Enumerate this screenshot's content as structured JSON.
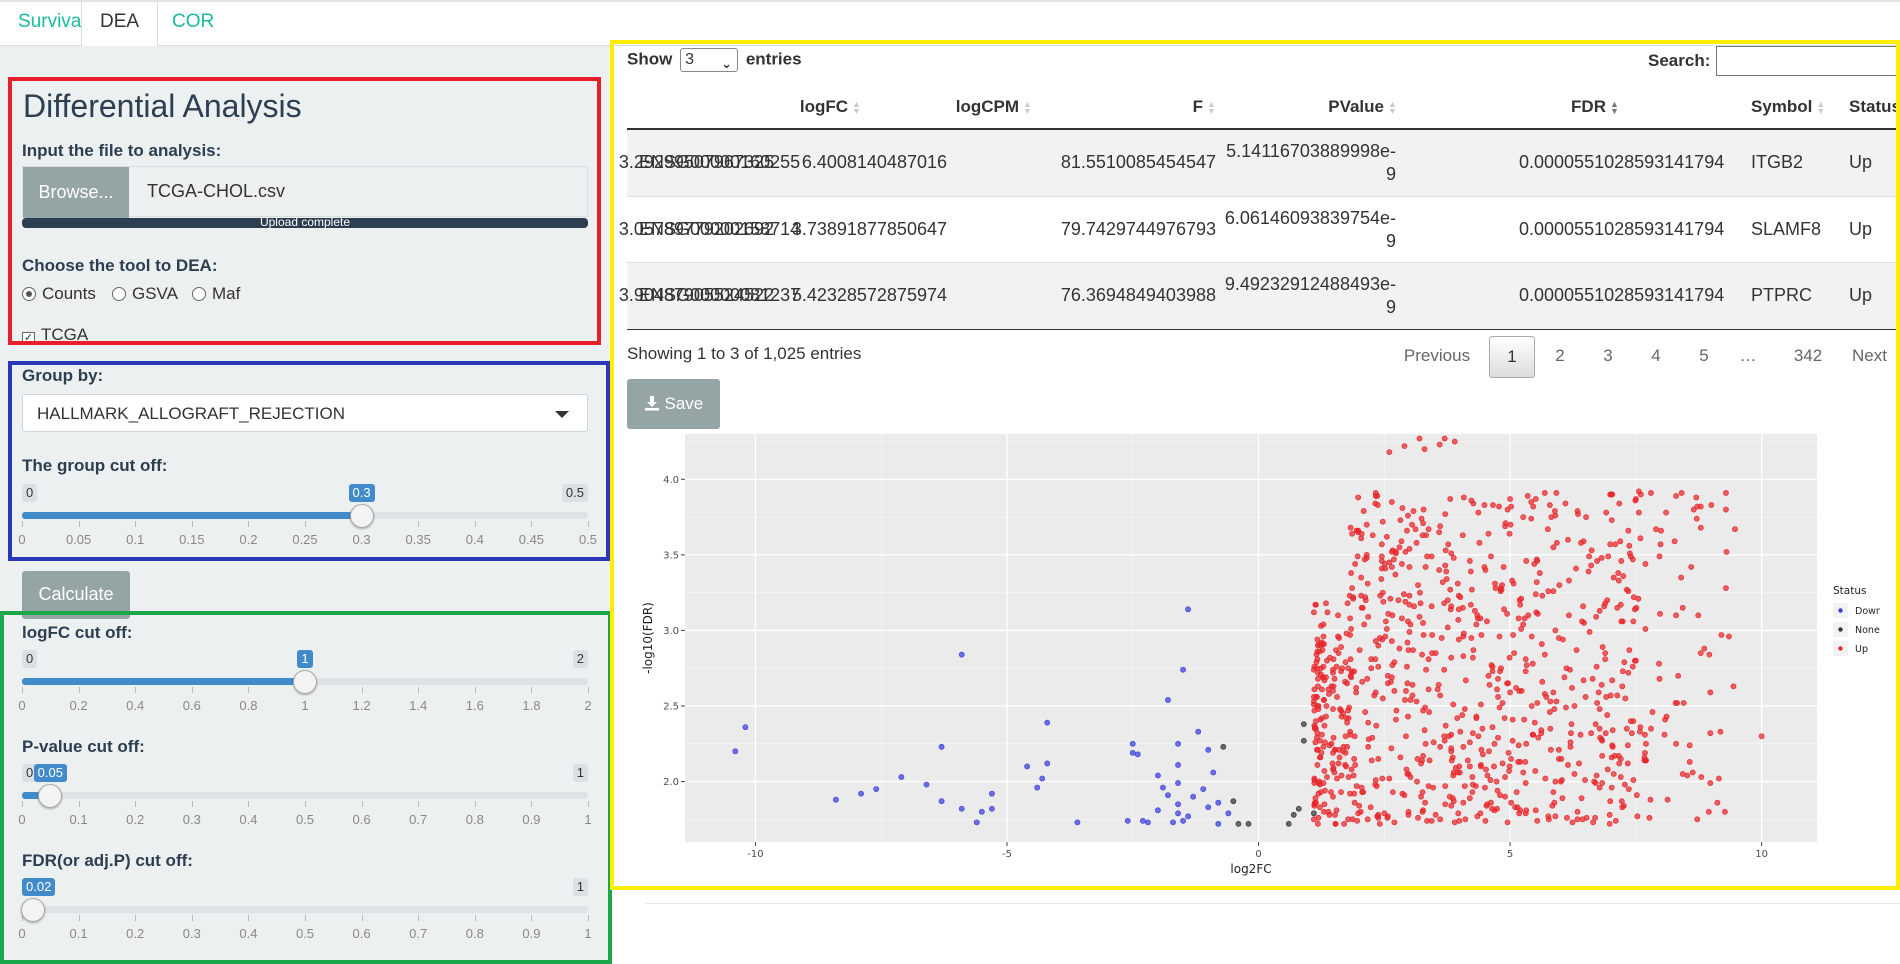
{
  "tabs": [
    {
      "label": "Survival",
      "active": false
    },
    {
      "label": "DEA",
      "active": true
    },
    {
      "label": "COR",
      "active": false
    }
  ],
  "sidebar": {
    "title": "Differential Analysis",
    "file_label": "Input the file to analysis:",
    "browse_label": "Browse...",
    "file_name": "TCGA-CHOL.csv",
    "upload_status": "Upload complete",
    "tool_label": "Choose the tool to DEA:",
    "tools": [
      {
        "label": "Counts",
        "selected": true
      },
      {
        "label": "GSVA",
        "selected": false
      },
      {
        "label": "Maf",
        "selected": false
      }
    ],
    "tcga_label": "TCGA",
    "tcga_checked": true,
    "group_label": "Group by:",
    "group_value": "HALLMARK_ALLOGRAFT_REJECTION",
    "calculate_label": "Calculate",
    "sliders": [
      {
        "label": "The group cut off:",
        "min": "0",
        "max": "0.5",
        "value": "0.3",
        "fraction": 0.6,
        "ticks": [
          "0",
          "0.05",
          "0.1",
          "0.15",
          "0.2",
          "0.25",
          "0.3",
          "0.35",
          "0.4",
          "0.45",
          "0.5"
        ]
      },
      {
        "label": "logFC cut off:",
        "min": "0",
        "max": "2",
        "value": "1",
        "fraction": 0.5,
        "ticks": [
          "0",
          "0.2",
          "0.4",
          "0.6",
          "0.8",
          "1",
          "1.2",
          "1.4",
          "1.6",
          "1.8",
          "2"
        ]
      },
      {
        "label": "P-value cut off:",
        "min": "0",
        "max": "1",
        "value": "0.05",
        "fraction": 0.05,
        "ticks": [
          "0",
          "0.1",
          "0.2",
          "0.3",
          "0.4",
          "0.5",
          "0.6",
          "0.7",
          "0.8",
          "0.9",
          "1"
        ]
      },
      {
        "label": "FDR(or adj.P) cut off:",
        "min": "0",
        "max": "1",
        "value": "0.02",
        "fraction": 0.02,
        "ticks": [
          "0",
          "0.1",
          "0.2",
          "0.3",
          "0.4",
          "0.5",
          "0.6",
          "0.7",
          "0.8",
          "0.9",
          "1"
        ]
      }
    ]
  },
  "table": {
    "show_label": "Show",
    "entries_label": "entries",
    "page_length": "3",
    "search_label": "Search:",
    "search_value": "",
    "columns": [
      "logFC",
      "logCPM",
      "F",
      "PValue",
      "FDR",
      "Symbol",
      "Status"
    ],
    "rows": [
      {
        "id": "ENSG00000160255",
        "logFC": "3.29299507967325",
        "logCPM": "6.4008140487016",
        "F": "81.5510085454547",
        "PValue_a": "5.14116703889998e-",
        "PValue_b": "9",
        "FDR": "0.0000551028593141794",
        "Symbol": "ITGB2",
        "Status": "Up"
      },
      {
        "id": "ENSG00000158714",
        "logFC": "3.05789779202692",
        "logCPM": "3.73891877850647",
        "F": "79.7429744976793",
        "PValue_a": "6.06146093839754e-",
        "PValue_b": "9",
        "FDR": "0.0000551028593141794",
        "Symbol": "SLAMF8",
        "Status": "Up"
      },
      {
        "id": "ENSG00000081237",
        "logFC": "3.90487905524522",
        "logCPM": "5.42328572875974",
        "F": "76.3694849403988",
        "PValue_a": "9.49232912488493e-",
        "PValue_b": "9",
        "FDR": "0.0000551028593141794",
        "Symbol": "PTPRC",
        "Status": "Up"
      }
    ],
    "info": "Showing 1 to 3 of 1,025 entries",
    "pager": [
      "Previous",
      "1",
      "2",
      "3",
      "4",
      "5",
      "…",
      "342",
      "Next"
    ]
  },
  "save_label": "Save",
  "colors": {
    "down": "#3b3bdf",
    "none": "#333333",
    "up": "#e8262b",
    "plot_bg": "#ebebeb",
    "accent": "#18bc9c",
    "slider": "#428bca",
    "highlight_red": "#e5202a",
    "highlight_blue": "#2a37b8",
    "highlight_green": "#1aa84a",
    "highlight_yellow": "#ffee00"
  },
  "chart_data": {
    "type": "scatter",
    "xlabel": "log2FC",
    "ylabel": "-log10(FDR)",
    "xlim": [
      -11.4,
      11.1
    ],
    "ylim": [
      1.6,
      4.3
    ],
    "x_ticks": [
      -10,
      -5,
      0,
      5,
      10
    ],
    "x_tick_labels": [
      "-10",
      "-5",
      "0",
      "5",
      "10"
    ],
    "y_ticks": [
      2.0,
      2.5,
      3.0,
      3.5,
      4.0
    ],
    "y_tick_labels": [
      "2.0",
      "2.5",
      "3.0",
      "3.5",
      "4.0"
    ],
    "grid": true,
    "legend_title": "Status",
    "legend_position": "right",
    "series": [
      {
        "name": "Down",
        "color": "#3b3bdf",
        "points": [
          [
            -10.4,
            2.2
          ],
          [
            -10.2,
            2.36
          ],
          [
            -8.4,
            1.88
          ],
          [
            -7.9,
            1.92
          ],
          [
            -7.6,
            1.95
          ],
          [
            -7.1,
            2.03
          ],
          [
            -6.6,
            1.98
          ],
          [
            -6.3,
            2.23
          ],
          [
            -6.3,
            1.87
          ],
          [
            -5.9,
            2.84
          ],
          [
            -5.9,
            1.82
          ],
          [
            -5.6,
            1.73
          ],
          [
            -5.5,
            1.8
          ],
          [
            -5.3,
            1.82
          ],
          [
            -5.3,
            1.92
          ],
          [
            -4.6,
            2.1
          ],
          [
            -4.4,
            1.96
          ],
          [
            -4.3,
            2.02
          ],
          [
            -4.2,
            2.12
          ],
          [
            -4.2,
            2.39
          ],
          [
            -3.6,
            1.73
          ],
          [
            -2.6,
            1.74
          ],
          [
            -2.5,
            2.25
          ],
          [
            -2.5,
            2.19
          ],
          [
            -2.4,
            2.18
          ],
          [
            -2.3,
            1.74
          ],
          [
            -2.2,
            1.73
          ],
          [
            -2.0,
            1.81
          ],
          [
            -2.0,
            2.04
          ],
          [
            -1.9,
            1.96
          ],
          [
            -1.8,
            1.91
          ],
          [
            -1.8,
            2.54
          ],
          [
            -1.7,
            1.73
          ],
          [
            -1.6,
            1.85
          ],
          [
            -1.6,
            1.99
          ],
          [
            -1.6,
            2.11
          ],
          [
            -1.6,
            2.25
          ],
          [
            -1.6,
            1.79
          ],
          [
            -1.5,
            2.74
          ],
          [
            -1.5,
            1.74
          ],
          [
            -1.4,
            3.14
          ],
          [
            -1.4,
            1.77
          ],
          [
            -1.3,
            1.9
          ],
          [
            -1.2,
            2.33
          ],
          [
            -1.1,
            1.95
          ],
          [
            -1.0,
            1.83
          ],
          [
            -1.0,
            2.21
          ],
          [
            -0.9,
            2.06
          ],
          [
            -0.8,
            1.86
          ],
          [
            -0.8,
            1.72
          ],
          [
            -0.6,
            1.79
          ]
        ]
      },
      {
        "name": "None",
        "color": "#333333",
        "points": [
          [
            -0.7,
            2.23
          ],
          [
            -0.5,
            1.87
          ],
          [
            -0.4,
            1.72
          ],
          [
            -0.2,
            1.72
          ],
          [
            0.6,
            1.72
          ],
          [
            0.7,
            1.78
          ],
          [
            0.8,
            1.82
          ],
          [
            0.9,
            2.27
          ],
          [
            0.9,
            2.38
          ],
          [
            1.1,
            1.79
          ]
        ]
      },
      {
        "name": "Up",
        "color": "#e8262b",
        "points": []
      }
    ]
  }
}
